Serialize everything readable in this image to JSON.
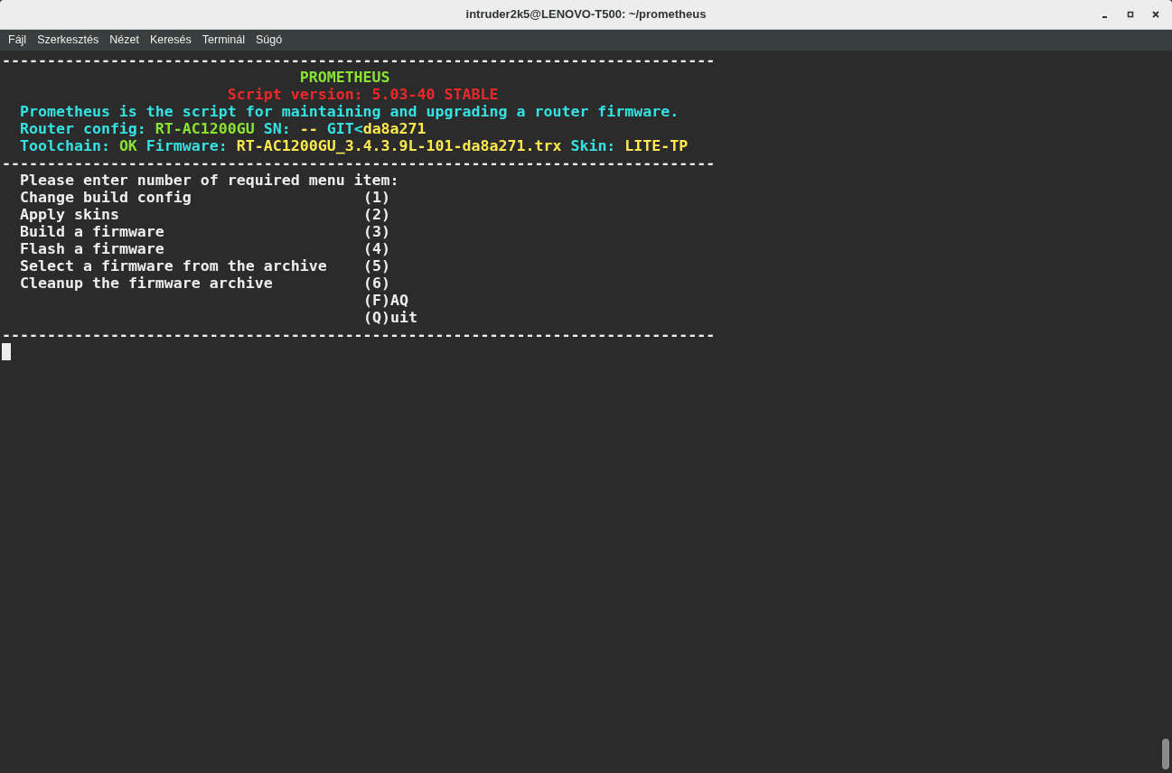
{
  "window": {
    "title": "intruder2k5@LENOVO-T500: ~/prometheus"
  },
  "menu_bar": [
    "Fájl",
    "Szerkesztés",
    "Nézet",
    "Keresés",
    "Terminál",
    "Súgó"
  ],
  "terminal": {
    "lines": [
      {
        "kind": "rule",
        "text": "-------------------------------------------------------------------------------"
      },
      {
        "kind": "text",
        "segments": [
          {
            "text": "                                 PROMETHEUS",
            "color": "#8ae234"
          }
        ]
      },
      {
        "kind": "text",
        "segments": [
          {
            "text": "                         Script version: 5.03-40 STABLE",
            "color": "#ef2929"
          }
        ]
      },
      {
        "kind": "text",
        "segments": [
          {
            "text": "  Prometheus is the script for maintaining and upgrading a router firmware.",
            "color": "#34e2e2"
          }
        ]
      },
      {
        "kind": "text",
        "segments": [
          {
            "text": "  Router config: ",
            "color": "#34e2e2"
          },
          {
            "text": "RT-AC1200GU",
            "color": "#8ae234"
          },
          {
            "text": " SN: ",
            "color": "#34e2e2"
          },
          {
            "text": "--",
            "color": "#fce94f"
          },
          {
            "text": " GIT<",
            "color": "#34e2e2"
          },
          {
            "text": "da8a271",
            "color": "#fce94f"
          }
        ]
      },
      {
        "kind": "text",
        "segments": [
          {
            "text": "  Toolchain: ",
            "color": "#34e2e2"
          },
          {
            "text": "OK",
            "color": "#8ae234"
          },
          {
            "text": " Firmware: ",
            "color": "#34e2e2"
          },
          {
            "text": "RT-AC1200GU_3.4.3.9L-101-da8a271.trx",
            "color": "#fce94f"
          },
          {
            "text": " Skin: ",
            "color": "#34e2e2"
          },
          {
            "text": "LITE-TP",
            "color": "#fce94f"
          }
        ]
      },
      {
        "kind": "rule",
        "text": "-------------------------------------------------------------------------------"
      },
      {
        "kind": "text",
        "segments": [
          {
            "text": "  Please enter number of required menu item:",
            "color": "#eeeeec"
          }
        ]
      },
      {
        "kind": "menu_item",
        "label": "Change build config",
        "key": "(1)"
      },
      {
        "kind": "menu_item",
        "label": "Apply skins",
        "key": "(2)"
      },
      {
        "kind": "menu_item",
        "label": "Build a firmware",
        "key": "(3)"
      },
      {
        "kind": "menu_item",
        "label": "Flash a firmware",
        "key": "(4)"
      },
      {
        "kind": "menu_item",
        "label": "Select a firmware from the archive",
        "key": "(5)"
      },
      {
        "kind": "menu_item",
        "label": "Cleanup the firmware archive",
        "key": "(6)"
      },
      {
        "kind": "menu_item",
        "key": "(F)AQ"
      },
      {
        "kind": "menu_item",
        "key": "(Q)uit"
      },
      {
        "kind": "rule",
        "text": "-------------------------------------------------------------------------------"
      },
      {
        "kind": "cursor"
      }
    ]
  }
}
